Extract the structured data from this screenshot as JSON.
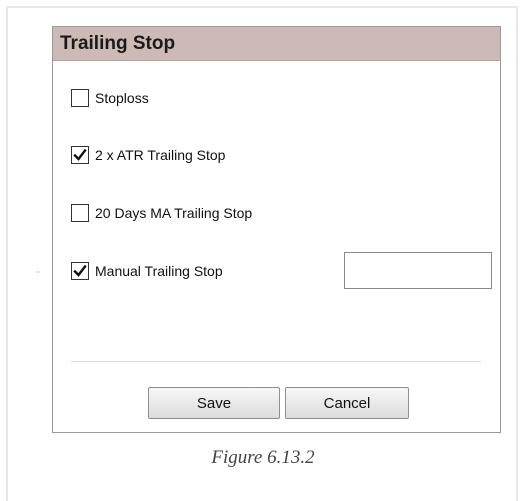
{
  "dialog": {
    "title": "Trailing Stop",
    "options": [
      {
        "label": "Stoploss",
        "checked": false
      },
      {
        "label": "2 x ATR Trailing Stop",
        "checked": true
      },
      {
        "label": "20 Days MA Trailing Stop",
        "checked": false
      },
      {
        "label": "Manual Trailing Stop",
        "checked": true
      }
    ],
    "manual_value": "",
    "save_label": "Save",
    "cancel_label": "Cancel"
  },
  "caption": "Figure 6.13.2",
  "colors": {
    "header_bg": "#cdb9b6",
    "border": "#9a9a9a"
  }
}
